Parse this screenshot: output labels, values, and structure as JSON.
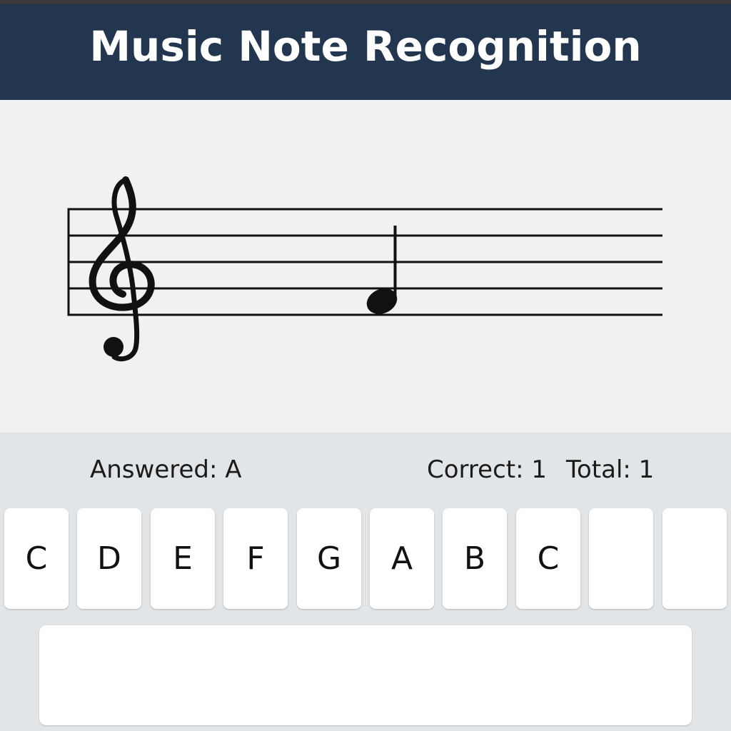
{
  "app": {
    "title": "Music Note Recognition"
  },
  "staff": {
    "clef": "treble-clef-icon",
    "note": "quarter-note-icon"
  },
  "status": {
    "answered": "Answered: A",
    "correct": "Correct: 1",
    "total": "Total: 1"
  },
  "keys": [
    {
      "label": "C"
    },
    {
      "label": "D"
    },
    {
      "label": "E"
    },
    {
      "label": "F"
    },
    {
      "label": "G"
    },
    {
      "label": "A"
    },
    {
      "label": "B"
    },
    {
      "label": "C"
    },
    {
      "label": ""
    },
    {
      "label": ""
    }
  ],
  "colors": {
    "header": "#22364f",
    "header_text": "#ffffff",
    "panel": "#e2e5e8",
    "staff_bg": "#f1f1f1",
    "key": "#ffffff"
  }
}
